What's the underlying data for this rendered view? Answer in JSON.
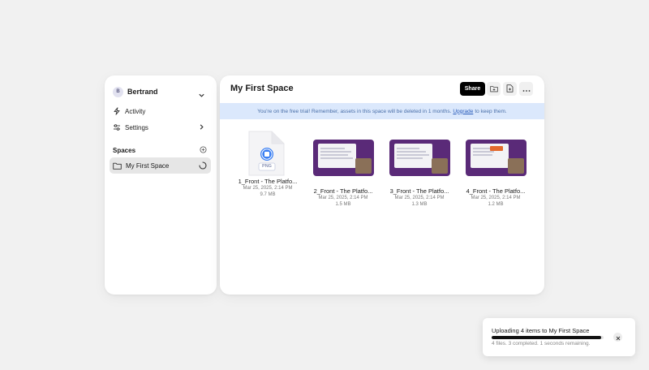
{
  "user": {
    "initial": "B",
    "name": "Bertrand"
  },
  "nav": {
    "activity": "Activity",
    "settings": "Settings"
  },
  "spaces": {
    "heading": "Spaces",
    "items": [
      {
        "label": "My First Space"
      }
    ]
  },
  "main": {
    "title": "My First Space",
    "share_label": "Share",
    "banner": {
      "text_before": "You're on the free trial! Remember, assets in this space will be deleted in 1 months.",
      "link": "Upgrade",
      "text_after": "to keep them."
    },
    "files": [
      {
        "name": "1_Front - The Platfo...",
        "date": "Mar 25, 2025, 2:14 PM",
        "size": "9.7 MB",
        "type_label": "PNG"
      },
      {
        "name": "2_Front - The Platfo...",
        "date": "Mar 25, 2025, 2:14 PM",
        "size": "1.5 MB"
      },
      {
        "name": "3_Front - The Platfo...",
        "date": "Mar 25, 2025, 2:14 PM",
        "size": "1.3 MB"
      },
      {
        "name": "4_Front - The Platfo...",
        "date": "Mar 25, 2025, 2:14 PM",
        "size": "1.2 MB"
      }
    ]
  },
  "toast": {
    "title": "Uploading 4 items to My First Space",
    "subtitle": "4 files. 3 completed. 1 seconds remaining.",
    "progress": 0.98
  },
  "colors": {
    "accent": "#000000",
    "banner_bg": "#dbe8fc",
    "banner_link": "#2458b8",
    "thumb_bg": "#5a2a78",
    "png_icon": "#3b7ff2"
  },
  "icons": [
    "chevron-down-icon",
    "lightning-icon",
    "sliders-icon",
    "chevron-right-icon",
    "plus-circle-icon",
    "folder-icon",
    "spinner-icon",
    "folder-plus-icon",
    "file-plus-icon",
    "more-icon",
    "close-icon"
  ]
}
